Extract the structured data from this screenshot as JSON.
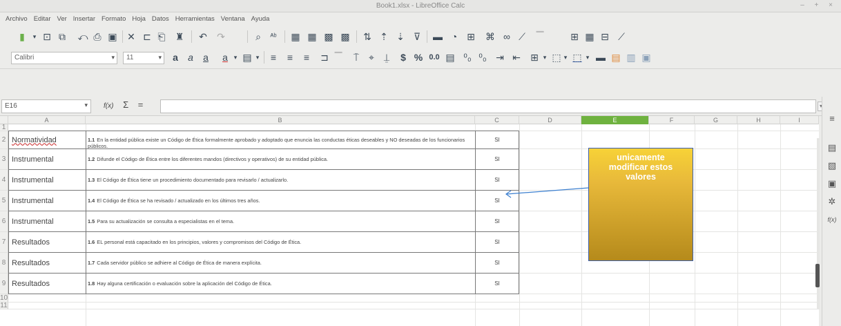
{
  "window": {
    "title": "Book1.xlsx - LibreOffice Calc",
    "controls": "– + ×"
  },
  "menu": [
    "Archivo",
    "Editar",
    "Ver",
    "Insertar",
    "Formato",
    "Hoja",
    "Datos",
    "Herramientas",
    "Ventana",
    "Ayuda"
  ],
  "toolbar": {
    "font_name": "Calibri",
    "font_size": "11",
    "percent": "%",
    "decimal": "0.0",
    "currency": "$"
  },
  "formula_bar": {
    "cell_ref": "E16",
    "fx": "f(x)",
    "sum": "Σ",
    "equals": "=",
    "value": ""
  },
  "grid": {
    "columns": [
      "A",
      "B",
      "C",
      "D",
      "E",
      "F",
      "G",
      "H",
      "I"
    ],
    "selected_column": "E",
    "rows": [
      {
        "num": "1",
        "a": "",
        "b_num": "",
        "b": "",
        "c": ""
      },
      {
        "num": "2",
        "a": "Normatividad",
        "b_num": "1.1",
        "b": "En la entidad pública existe un Código de Ética formalmente aprobado y adoptado que enuncia las conductas éticas deseables y NO deseadas de los funcionarios públicos.",
        "c": "SI"
      },
      {
        "num": "3",
        "a": "Instrumental",
        "b_num": "1.2",
        "b": "Difunde el Código de Ética entre los diferentes mandos (directivos y operativos) de su entidad pública.",
        "c": "SI"
      },
      {
        "num": "4",
        "a": "Instrumental",
        "b_num": "1.3",
        "b": "El Código de Ética tiene un procedimiento documentado para revisarlo / actualizarlo.",
        "c": "SI"
      },
      {
        "num": "5",
        "a": "Instrumental",
        "b_num": "1.4",
        "b": "El Código de Ética se ha revisado / actualizado en los últimos tres años.",
        "c": "SI"
      },
      {
        "num": "6",
        "a": "Instrumental",
        "b_num": "1.5",
        "b": "Para su actualización se consulta a especialistas en el tema.",
        "c": "SI"
      },
      {
        "num": "7",
        "a": "Resultados",
        "b_num": "1.6",
        "b": "EL personal está capacitado en los principios, valores y compromisos del Código de Ética.",
        "c": "SI"
      },
      {
        "num": "8",
        "a": "Resultados",
        "b_num": "1.7",
        "b": "Cada servidor público se adhiere al Código de Ética de manera explícita.",
        "c": "SI"
      },
      {
        "num": "9",
        "a": "Resultados",
        "b_num": "1.8",
        "b": "Hay alguna certificación o evaluación sobre la aplicación del Código de Ética.",
        "c": "SI"
      },
      {
        "num": "10",
        "a": "",
        "b_num": "",
        "b": "",
        "c": ""
      },
      {
        "num": "11",
        "a": "",
        "b_num": "",
        "b": "",
        "c": ""
      }
    ]
  },
  "callout": {
    "line1": "unicamente",
    "line2": "modificar estos",
    "line3": "valores"
  },
  "colors": {
    "selected_column": "#6fb23f",
    "callout_top": "#f7d237",
    "callout_bottom": "#b58a1b",
    "arrow": "#3b7fd0"
  }
}
